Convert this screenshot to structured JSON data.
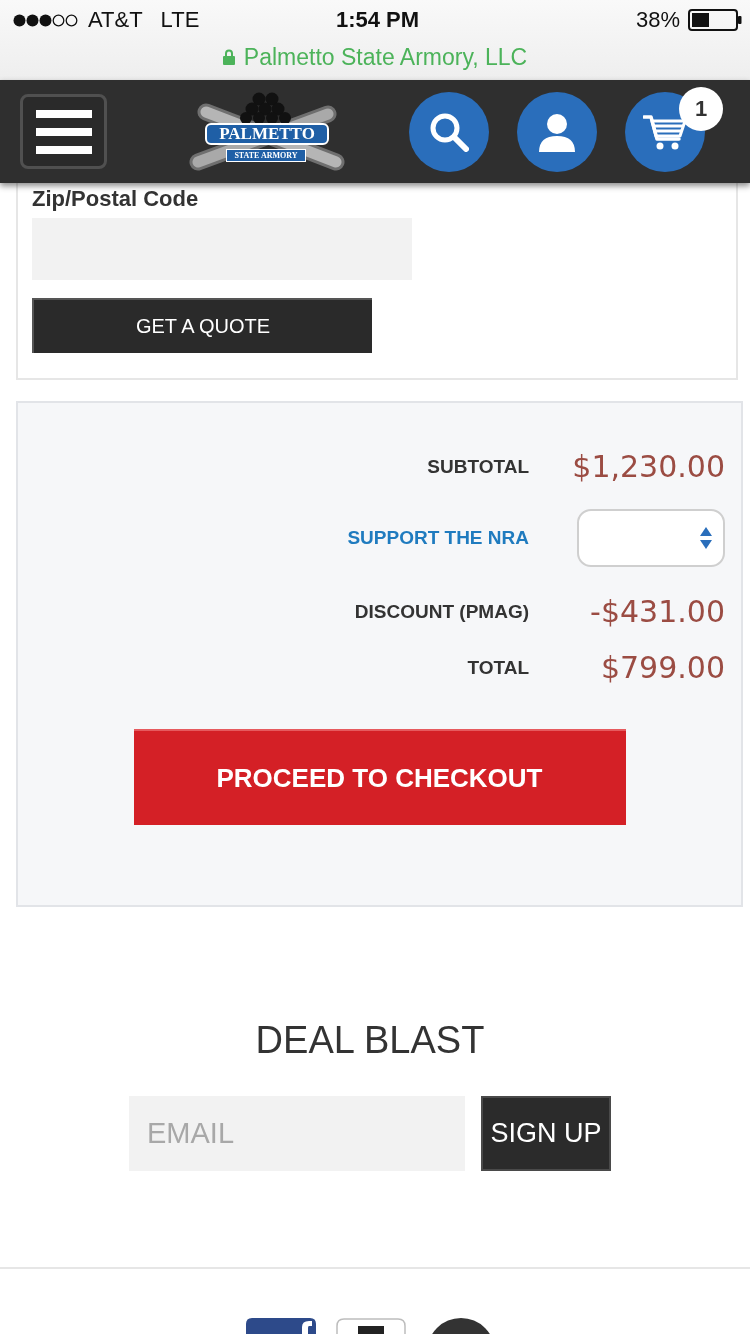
{
  "status_bar": {
    "carrier": "AT&T",
    "network": "LTE",
    "time": "1:54 PM",
    "battery": "38%"
  },
  "address_bar": {
    "secure": true,
    "site": "Palmetto State Armory, LLC"
  },
  "header": {
    "logo": {
      "title": "PALMETTO",
      "tagline": "STATE ARMORY"
    },
    "cart_count": "1"
  },
  "shipping_quote": {
    "field_label": "Zip/Postal Code",
    "button": "GET A QUOTE"
  },
  "totals": {
    "rows": [
      {
        "kind": "amount",
        "label": "SUBTOTAL",
        "value": "$1,230.00"
      },
      {
        "kind": "select",
        "label": "SUPPORT THE NRA"
      },
      {
        "kind": "amount",
        "label": "DISCOUNT (PMAG)",
        "value": "-$431.00"
      },
      {
        "kind": "amount",
        "label": "TOTAL",
        "value": "$799.00"
      }
    ],
    "checkout_button": "PROCEED TO CHECKOUT"
  },
  "newsletter": {
    "title": "DEAL BLAST",
    "placeholder": "EMAIL",
    "button": "SIGN UP"
  }
}
